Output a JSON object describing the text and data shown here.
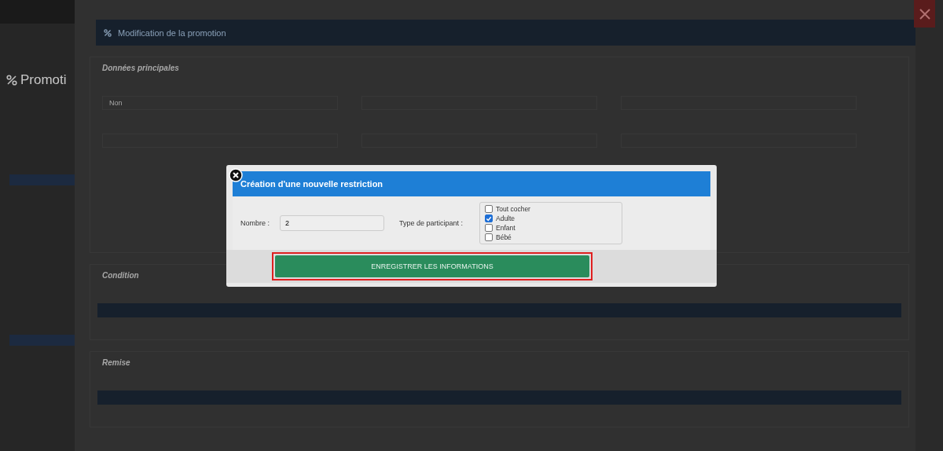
{
  "background": {
    "page_title": "Promoti",
    "dialog_title": "Modification de la promotion",
    "sections": [
      {
        "title": "Données principales"
      },
      {
        "title": "Condition"
      },
      {
        "title": "Remise"
      }
    ],
    "select_value": "Non"
  },
  "modal": {
    "title": "Création d'une nouvelle restriction",
    "number": {
      "label": "Nombre :",
      "value": "2"
    },
    "participant": {
      "label": "Type de participant :",
      "options": [
        {
          "label": "Tout cocher",
          "checked": false
        },
        {
          "label": "Adulte",
          "checked": true
        },
        {
          "label": "Enfant",
          "checked": false
        },
        {
          "label": "Bébé",
          "checked": false
        }
      ]
    },
    "save_button": {
      "label": "ENREGISTRER LES INFORMATIONS",
      "highlighted": true
    }
  }
}
